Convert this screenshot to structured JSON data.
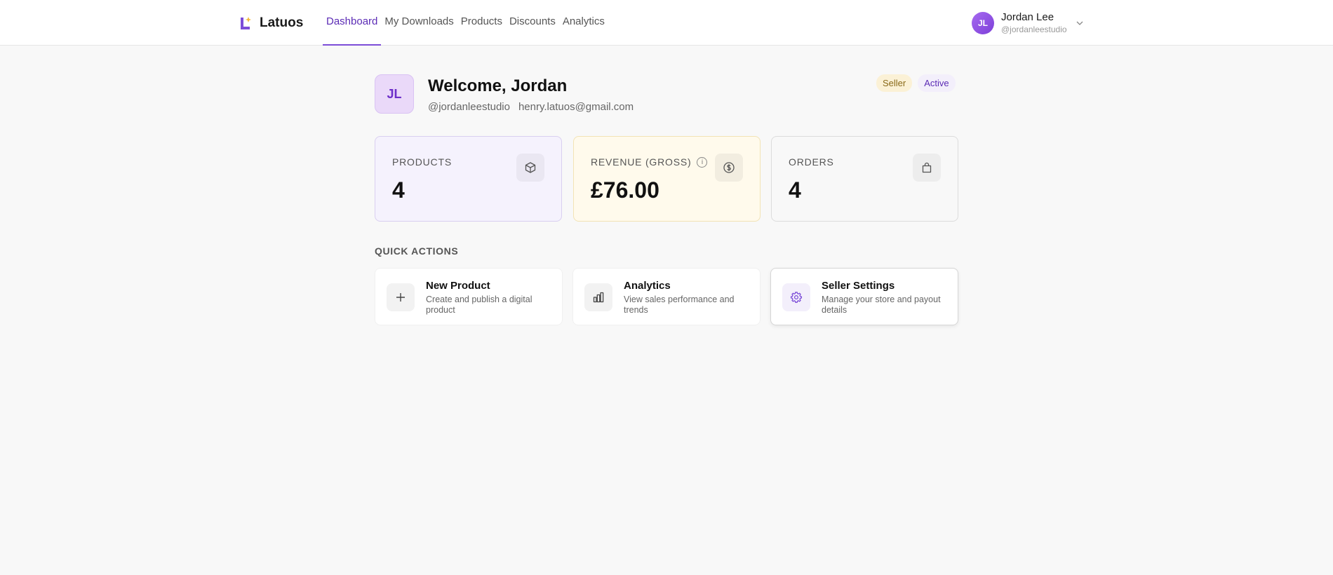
{
  "brand": {
    "name": "Latuos",
    "accent": "#7c4dd8"
  },
  "nav": {
    "items": [
      {
        "label": "Dashboard",
        "active": true
      },
      {
        "label": "My Downloads",
        "active": false
      },
      {
        "label": "Products",
        "active": false
      },
      {
        "label": "Discounts",
        "active": false
      },
      {
        "label": "Analytics",
        "active": false
      }
    ]
  },
  "user": {
    "initials": "JL",
    "name": "Jordan Lee",
    "handle": "@jordanleestudio"
  },
  "welcome": {
    "initials": "JL",
    "title": "Welcome, Jordan",
    "handle": "@jordanleestudio",
    "email": "henry.latuos@gmail.com",
    "badges": {
      "seller": "Seller",
      "active": "Active"
    }
  },
  "stats": {
    "products": {
      "label": "PRODUCTS",
      "value": "4",
      "icon": "box-icon"
    },
    "revenue": {
      "label": "REVENUE (GROSS)",
      "value": "£76.00",
      "icon": "dollar-circle-icon",
      "info": "i"
    },
    "orders": {
      "label": "ORDERS",
      "value": "4",
      "icon": "shopping-bag-icon"
    }
  },
  "quick_actions": {
    "title": "QUICK ACTIONS",
    "items": [
      {
        "name": "New Product",
        "desc": "Create and publish a digital product",
        "icon": "plus-icon"
      },
      {
        "name": "Analytics",
        "desc": "View sales performance and trends",
        "icon": "bar-chart-icon"
      },
      {
        "name": "Seller Settings",
        "desc": "Manage your store and payout details",
        "icon": "gear-icon"
      }
    ]
  }
}
